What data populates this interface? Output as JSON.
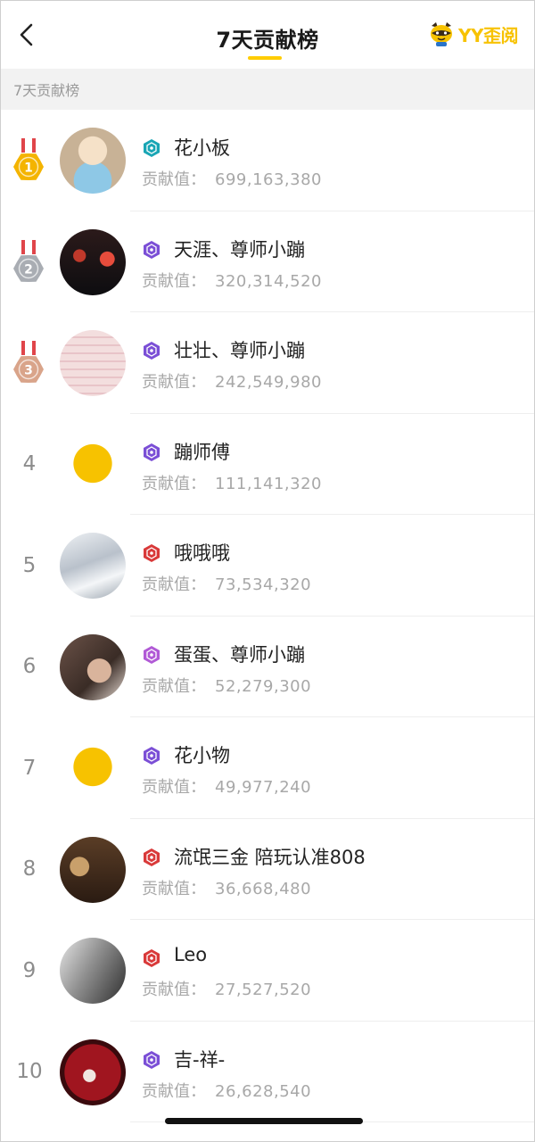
{
  "header": {
    "title": "7天贡献榜",
    "brand": "YY歪阅",
    "accent": "#ffcc00"
  },
  "section": {
    "label": "7天贡献榜"
  },
  "value_label": "贡献值：",
  "colors": {
    "badge_teal": "#1aa6b5",
    "badge_purple": "#7b4fd6",
    "badge_red": "#d93a3a",
    "badge_violet": "#b15ad6",
    "gold": "#f4b400",
    "silver": "#a9adb3",
    "bronze": "#d9a48a"
  },
  "entries": [
    {
      "rank": "1",
      "medal": "gold",
      "badge": "teal",
      "name": "花小板",
      "value": "699,163,380"
    },
    {
      "rank": "2",
      "medal": "silver",
      "badge": "purple",
      "name": "天涯、尊师小蹦",
      "value": "320,314,520"
    },
    {
      "rank": "3",
      "medal": "bronze",
      "badge": "purple",
      "name": "壮壮、尊师小蹦",
      "value": "242,549,980"
    },
    {
      "rank": "4",
      "medal": "",
      "badge": "purple",
      "name": "蹦师傅",
      "value": "111,141,320"
    },
    {
      "rank": "5",
      "medal": "",
      "badge": "red",
      "name": "哦哦哦",
      "value": "73,534,320"
    },
    {
      "rank": "6",
      "medal": "",
      "badge": "violet",
      "name": "蛋蛋、尊师小蹦",
      "value": "52,279,300"
    },
    {
      "rank": "7",
      "medal": "",
      "badge": "purple",
      "name": "花小物",
      "value": "49,977,240"
    },
    {
      "rank": "8",
      "medal": "",
      "badge": "red",
      "name": "流氓三金 陪玩认准808",
      "value": "36,668,480"
    },
    {
      "rank": "9",
      "medal": "",
      "badge": "red",
      "name": "Leo",
      "value": "27,527,520"
    },
    {
      "rank": "10",
      "medal": "",
      "badge": "purple",
      "name": "吉-祥-",
      "value": "26,628,540"
    }
  ]
}
